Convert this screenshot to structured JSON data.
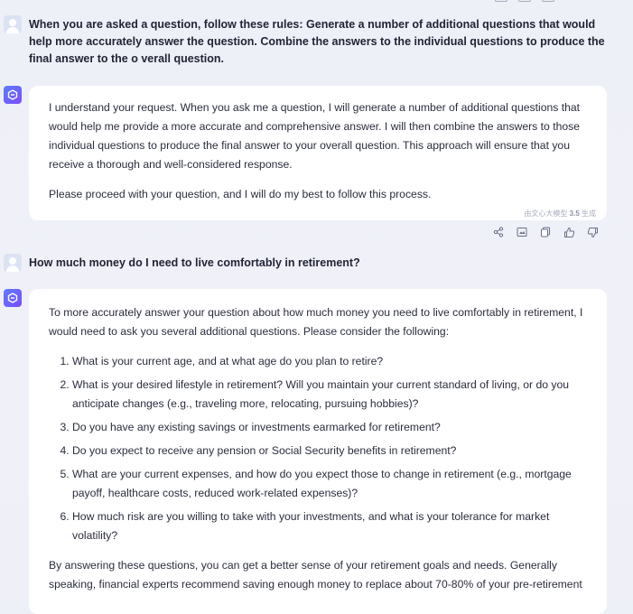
{
  "messages": {
    "user_1": "When you are asked a question, follow these rules: Generate a number of additional questions that would help more accurately answer the question. Combine the answers to the individual questions to produce the final answer to the o verall question.",
    "bot_1": {
      "p1": "I understand your request. When you ask me a question, I will generate a number of additional questions that would help me provide a more accurate and comprehensive answer. I will then combine the answers to those individual questions to produce the final answer to your overall question. This approach will ensure that you receive a thorough and well-considered response.",
      "p2": "Please proceed with your question, and I will do my best to follow this process.",
      "watermark_prefix": "由文心大模型",
      "watermark_version": "3.5",
      "watermark_suffix": "生成"
    },
    "user_2": "How much money do I need to live comfortably in retirement?",
    "bot_2": {
      "intro": "To more accurately answer your question about how much money you need to live comfortably in retirement, I would need to ask you several additional questions. Please consider the following:",
      "questions": [
        "What is your current age, and at what age do you plan to retire?",
        "What is your desired lifestyle in retirement? Will you maintain your current standard of living, or do you anticipate changes (e.g., traveling more, relocating, pursuing hobbies)?",
        "Do you have any existing savings or investments earmarked for retirement?",
        "Do you expect to receive any pension or Social Security benefits in retirement?",
        "What are your current expenses, and how do you expect those to change in retirement (e.g., mortgage payoff, healthcare costs, reduced work-related expenses)?",
        "How much risk are you willing to take with your investments, and what is your tolerance for market volatility?"
      ],
      "outro": "By answering these questions, you can get a better sense of your retirement goals and needs. Generally speaking, financial experts recommend saving enough money to replace about 70-80% of your pre-retirement"
    }
  },
  "icons": {
    "toolbar": [
      "share-icon",
      "image-icon",
      "copy-icon",
      "thumbs-up-icon",
      "thumbs-down-icon"
    ]
  }
}
